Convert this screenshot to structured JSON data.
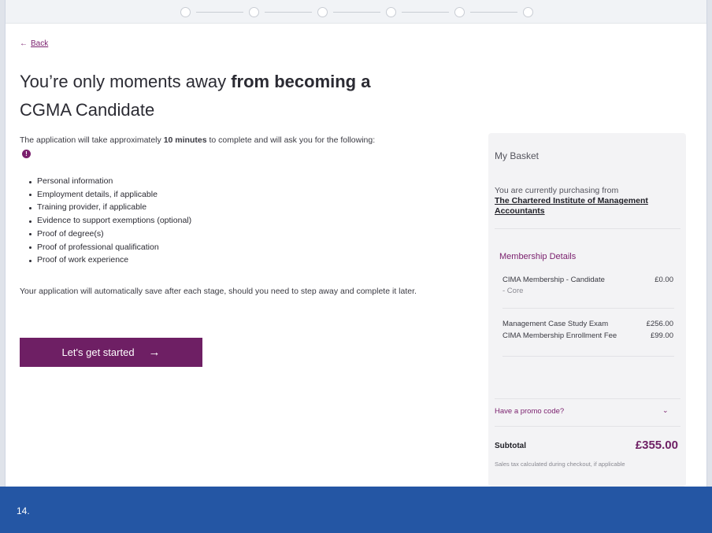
{
  "back": {
    "arrow": "←",
    "label": "Back"
  },
  "headline": {
    "part1": "You’re only moments away ",
    "part2": "from becoming a",
    "part3": "CGMA Candidate"
  },
  "intro": {
    "before": "The application will take approximately ",
    "bold": "10 minutes",
    "after": " to complete and will ask you for the following:",
    "info_icon": "!"
  },
  "requirements": [
    "Personal information",
    "Employment details, if applicable",
    "Training provider, if applicable",
    "Evidence to support exemptions (optional)",
    "Proof of degree(s)",
    "Proof of professional qualification",
    "Proof of work experience"
  ],
  "autosave_text": "Your application will automatically save after each stage, should you need to step away and complete it later.",
  "cta": {
    "label": "Let's get started",
    "arrow": "→"
  },
  "basket": {
    "title": "My Basket",
    "purchasing_from": "You are currently purchasing from",
    "organization": "The Chartered Institute of Management Accountants",
    "section_title": "Membership Details",
    "items": [
      {
        "name": "CIMA Membership - Candidate",
        "sub": "- Core",
        "price": "£0.00"
      },
      {
        "name": "Management Case Study Exam",
        "price": "£256.00"
      },
      {
        "name": "CIMA Membership Enrollment Fee",
        "price": "£99.00"
      }
    ],
    "promo_label": "Have a promo code?",
    "promo_chevron": "⌄",
    "subtotal_label": "Subtotal",
    "subtotal_value": "£355.00",
    "tax_note": "Sales tax calculated during checkout, if applicable"
  },
  "footer": {
    "step_number": "14."
  },
  "colors": {
    "accent": "#6e1f64",
    "footer_bg": "#2456a4",
    "basket_bg": "#f3f3f5"
  },
  "icons": {
    "back": "arrow-left-icon",
    "cta": "arrow-right-icon",
    "info": "info-icon",
    "promo": "chevron-down-icon"
  }
}
